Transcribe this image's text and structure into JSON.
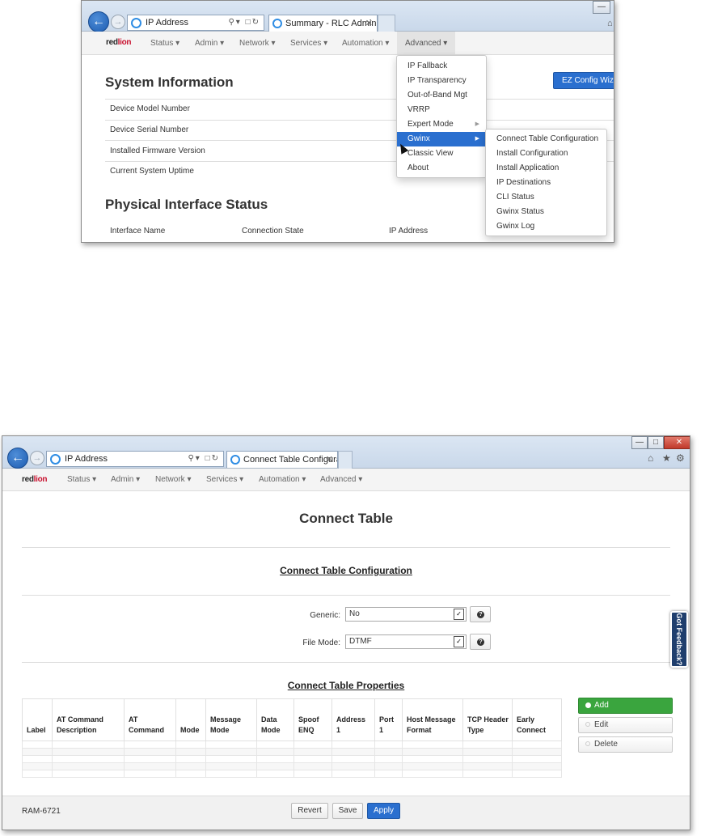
{
  "top_window": {
    "address": "IP Address",
    "tab_title": "Summary - RLC Administra...",
    "logo": {
      "brand_left": "red",
      "brand_right": "lion"
    },
    "nav": [
      "Status",
      "Admin",
      "Network",
      "Services",
      "Automation",
      "Advanced"
    ],
    "page_title": "System Information",
    "rows": [
      "Device Model Number",
      "Device Serial Number",
      "Installed Firmware Version",
      "Current System Uptime"
    ],
    "ez_button": "EZ Config Wiza",
    "section2_title": "Physical Interface Status",
    "columns": [
      "Interface Name",
      "Connection State",
      "IP Address"
    ],
    "advanced_menu": [
      "IP Fallback",
      "IP Transparency",
      "Out-of-Band Mgt",
      "VRRP",
      "Expert Mode",
      "Gwinx",
      "Classic View",
      "About"
    ],
    "gwinx_submenu": [
      "Connect Table Configuration",
      "Install Configuration",
      "Install Application",
      "IP Destinations",
      "CLI Status",
      "Gwinx Status",
      "Gwinx Log"
    ]
  },
  "bottom_window": {
    "address": "IP Address",
    "tab_title": "Connect Table Configurati...",
    "logo": {
      "brand_left": "red",
      "brand_right": "lion"
    },
    "nav": [
      "Status",
      "Admin",
      "Network",
      "Services",
      "Automation",
      "Advanced"
    ],
    "page_title": "Connect Table",
    "config_section": "Connect Table Configuration",
    "generic_label": "Generic:",
    "generic_value": "No",
    "filemode_label": "File Mode:",
    "filemode_value": "DTMF",
    "properties_section": "Connect Table Properties",
    "table_headers": [
      "Label",
      "AT Command Description",
      "AT Command",
      "Mode",
      "Message Mode",
      "Data Mode",
      "Spoof ENQ",
      "Address 1",
      "Port 1",
      "Host Message Format",
      "TCP Header Type",
      "Early Connect"
    ],
    "buttons": {
      "add": "Add",
      "edit": "Edit",
      "delete": "Delete"
    },
    "footer": {
      "model": "RAM-6721",
      "revert": "Revert",
      "save": "Save",
      "apply": "Apply"
    },
    "feedback": "Got Feedback?"
  }
}
